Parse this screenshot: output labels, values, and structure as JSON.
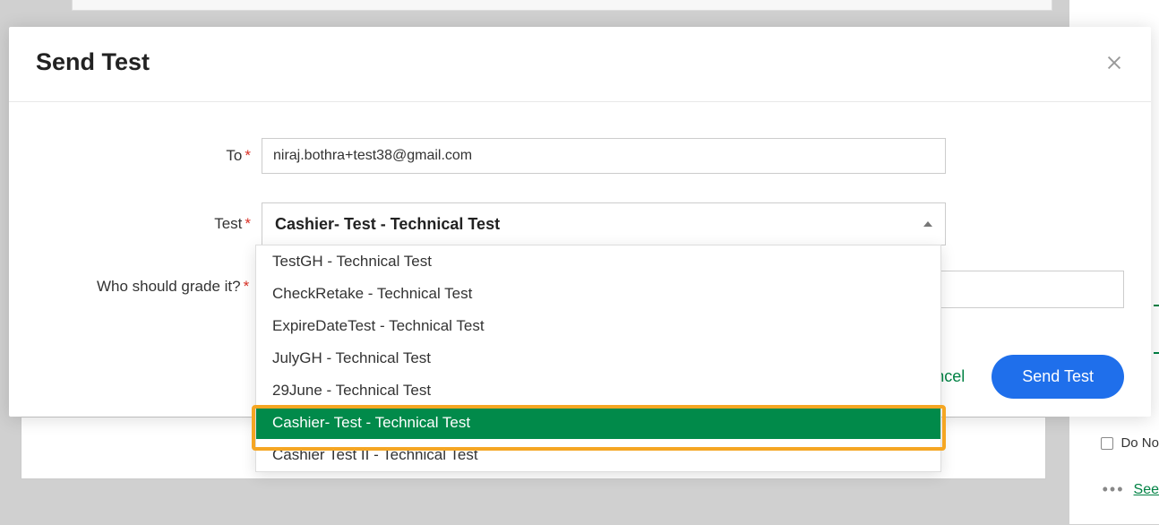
{
  "modal": {
    "title": "Send Test",
    "labels": {
      "to": "To",
      "test": "Test",
      "grader": "Who should grade it?"
    },
    "fields": {
      "to_value": "niraj.bothra+test38@gmail.com",
      "test_selected": "Cashier- Test - Technical Test"
    },
    "buttons": {
      "cancel": "Cancel",
      "send": "Send Test"
    }
  },
  "dropdown": {
    "options": [
      "TestGH - Technical Test",
      "CheckRetake - Technical Test",
      "ExpireDateTest - Technical Test",
      "JulyGH - Technical Test",
      "29June - Technical Test",
      "Cashier- Test - Technical Test",
      "Cashier Test II - Technical Test"
    ],
    "selected_index": 5
  },
  "background": {
    "do_not_label": "Do No",
    "see_label": "See",
    "cancel_remnant": "el"
  }
}
